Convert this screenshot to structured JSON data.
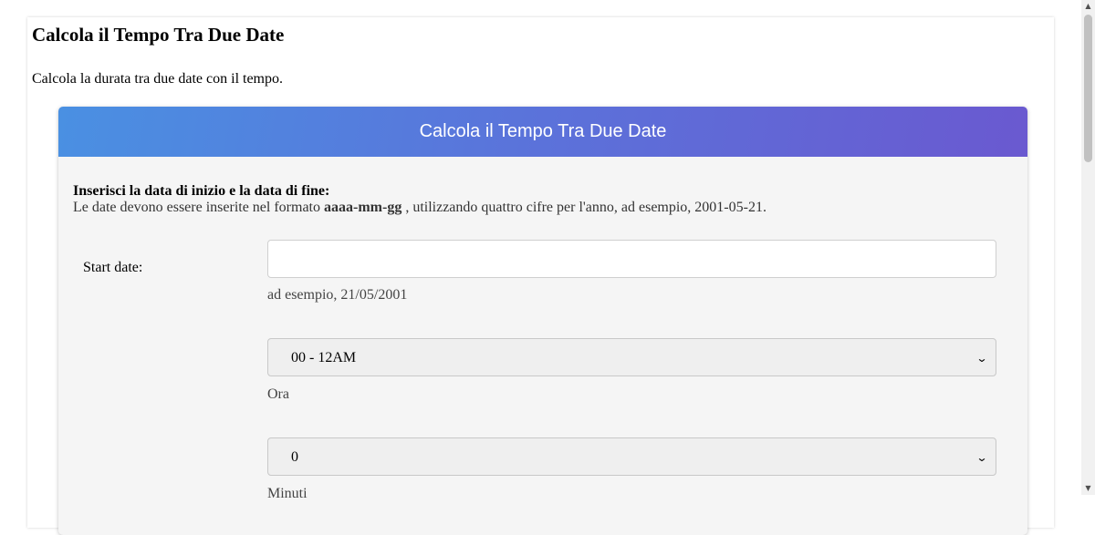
{
  "page": {
    "title": "Calcola il Tempo Tra Due Date",
    "intro": "Calcola la durata tra due date con il tempo."
  },
  "card": {
    "header": "Calcola il Tempo Tra Due Date",
    "instructions_lead": "Inserisci la data di inizio e la data di fine:",
    "instructions_before": "Le date devono essere inserite nel formato ",
    "instructions_format": "aaaa-mm-gg",
    "instructions_after": " , utilizzando quattro cifre per l'anno, ad esempio, 2001-05-21."
  },
  "start": {
    "label": "Start date:",
    "date_value": "",
    "date_hint": "ad esempio, 21/05/2001",
    "hour_selected": "00 - 12AM",
    "hour_hint": "Ora",
    "minute_selected": "0",
    "minute_hint": "Minuti"
  },
  "icons": {
    "select_arrow": "chevron-down-icon",
    "scroll_up": "scroll-up-arrow-icon",
    "scroll_down": "scroll-down-arrow-icon"
  }
}
